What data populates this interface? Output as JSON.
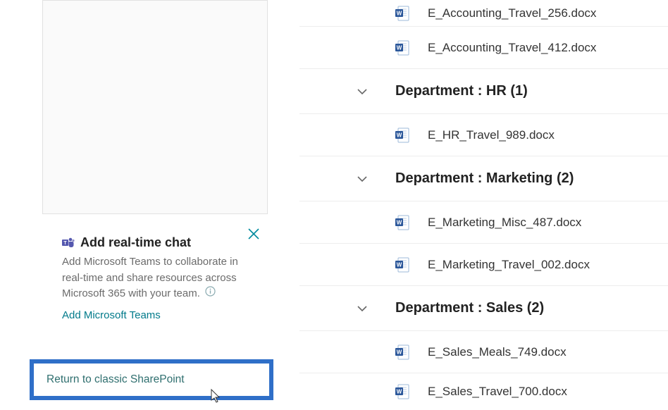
{
  "colors": {
    "word_blue": "#2b579a",
    "word_blue_dark": "#1f4887",
    "teal_link": "#007a8a",
    "highlight_border": "#2f6fc8",
    "close_teal": "#008a9e",
    "gray_text": "#6b6b6b"
  },
  "promo": {
    "title": "Add real-time chat",
    "desc": "Add Microsoft Teams to collaborate in real-time and share resources across Microsoft 365 with your team.",
    "link": "Add Microsoft Teams",
    "teams_icon": "teams-icon",
    "info_icon": "info-icon",
    "close_icon": "close-icon"
  },
  "return_link": "Return to classic SharePoint",
  "groups": [
    {
      "title_prefix": "Department :",
      "title_value": "HR",
      "count": 1,
      "files": [
        "E_HR_Travel_989.docx"
      ]
    },
    {
      "title_prefix": "Department :",
      "title_value": "Marketing",
      "count": 2,
      "files": [
        "E_Marketing_Misc_487.docx",
        "E_Marketing_Travel_002.docx"
      ]
    },
    {
      "title_prefix": "Department :",
      "title_value": "Sales",
      "count": 2,
      "files": [
        "E_Sales_Meals_749.docx",
        "E_Sales_Travel_700.docx"
      ]
    }
  ],
  "toprow_files": [
    "E_Accounting_Travel_256.docx",
    "E_Accounting_Travel_412.docx"
  ]
}
